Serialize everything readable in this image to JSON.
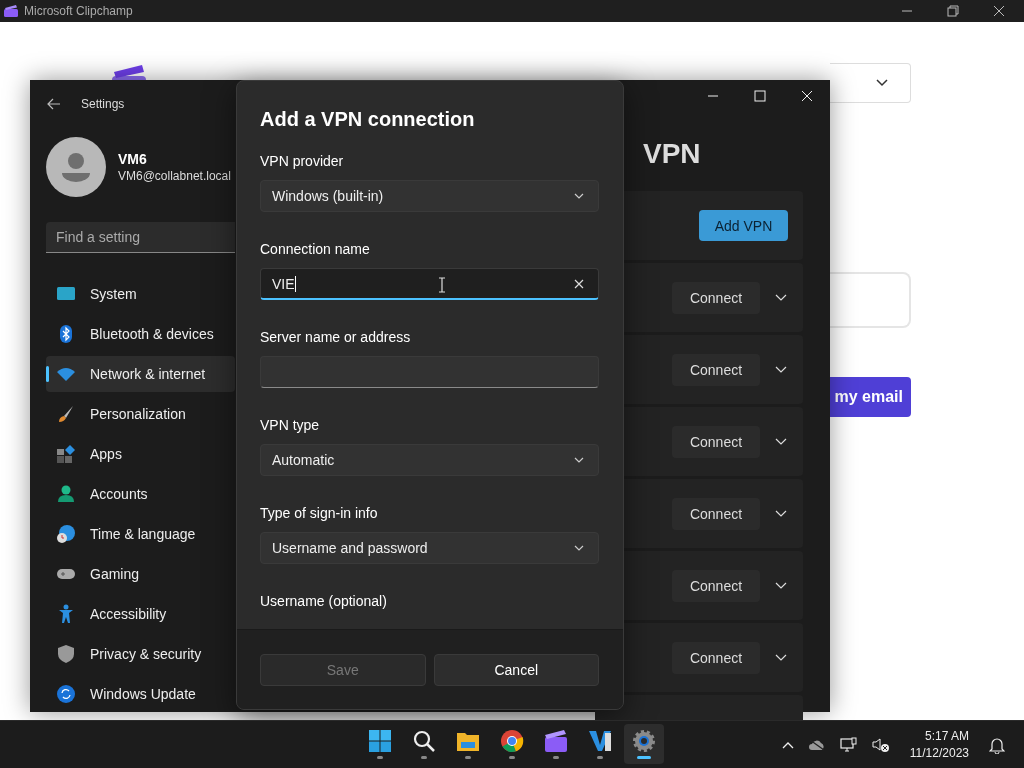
{
  "app_window": {
    "title": "Microsoft Clipchamp",
    "email_button": "my email"
  },
  "settings": {
    "title": "Settings",
    "user": {
      "name": "VM6",
      "email": "VM6@collabnet.local"
    },
    "search": {
      "placeholder": "Find a setting"
    },
    "nav": [
      {
        "label": "System",
        "kind": "system",
        "selected": false
      },
      {
        "label": "Bluetooth & devices",
        "kind": "bluetooth",
        "selected": false
      },
      {
        "label": "Network & internet",
        "kind": "network",
        "selected": true
      },
      {
        "label": "Personalization",
        "kind": "personalization",
        "selected": false
      },
      {
        "label": "Apps",
        "kind": "apps",
        "selected": false
      },
      {
        "label": "Accounts",
        "kind": "accounts",
        "selected": false
      },
      {
        "label": "Time & language",
        "kind": "time",
        "selected": false
      },
      {
        "label": "Gaming",
        "kind": "gaming",
        "selected": false
      },
      {
        "label": "Accessibility",
        "kind": "accessibility",
        "selected": false
      },
      {
        "label": "Privacy & security",
        "kind": "privacy",
        "selected": false
      },
      {
        "label": "Windows Update",
        "kind": "update",
        "selected": false
      }
    ],
    "page_title": "VPN",
    "add_button": "Add VPN",
    "connections": [
      {
        "button": "Connect"
      },
      {
        "button": "Connect"
      },
      {
        "button": "Connect"
      },
      {
        "button": "Connect"
      },
      {
        "button": "Connect"
      },
      {
        "button": "Connect"
      }
    ]
  },
  "dialog": {
    "title": "Add a VPN connection",
    "fields": [
      {
        "kind": "select",
        "label": "VPN provider",
        "value": "Windows (built-in)"
      },
      {
        "kind": "text",
        "label": "Connection name",
        "value": "VIE",
        "focused": true
      },
      {
        "kind": "text",
        "label": "Server name or address",
        "focused": false
      },
      {
        "kind": "select",
        "label": "VPN type",
        "value": "Automatic"
      },
      {
        "kind": "select",
        "label": "Type of sign-in info",
        "value": "Username and password"
      },
      {
        "kind": "label",
        "label": "Username (optional)"
      }
    ],
    "buttons": [
      {
        "label": "Save",
        "disabled": true
      },
      {
        "label": "Cancel",
        "disabled": false
      }
    ]
  },
  "taskbar": {
    "apps": [
      {
        "kind": "start",
        "selected": false
      },
      {
        "kind": "search",
        "selected": false
      },
      {
        "kind": "explorer",
        "selected": false
      },
      {
        "kind": "chrome",
        "selected": false
      },
      {
        "kind": "clipchamp",
        "selected": false
      },
      {
        "kind": "editor",
        "selected": false
      },
      {
        "kind": "settings",
        "selected": true
      }
    ],
    "time": "5:17 AM",
    "date": "11/12/2023"
  }
}
